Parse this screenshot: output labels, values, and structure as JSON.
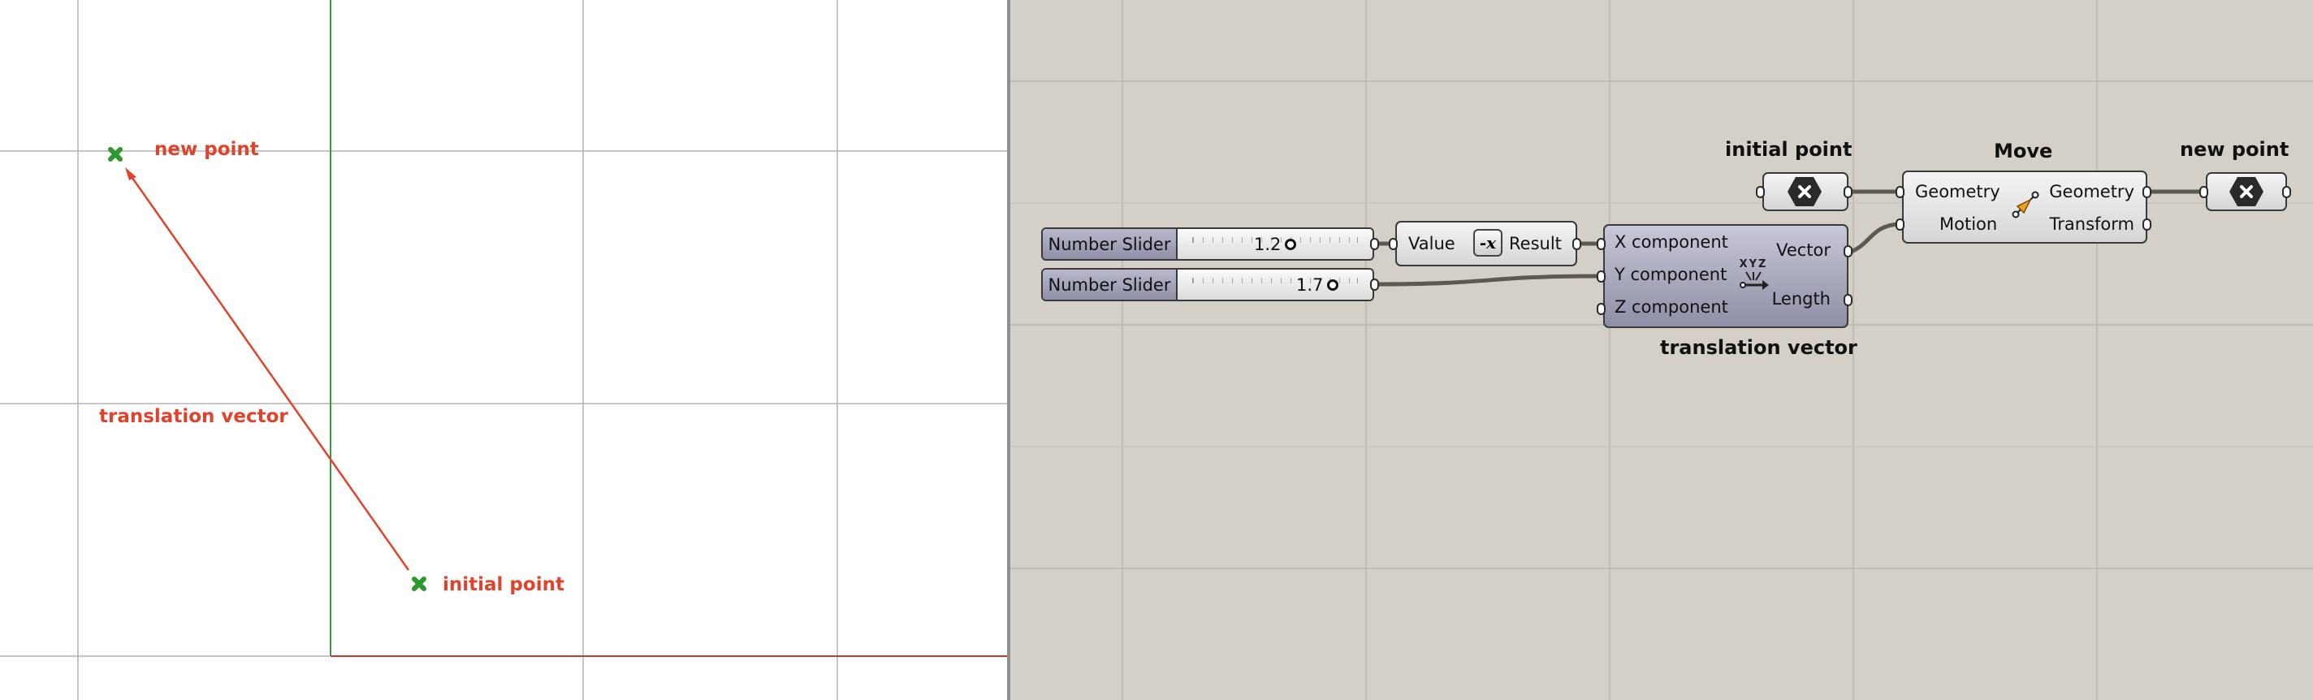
{
  "viewport": {
    "labels": {
      "new_point": "new point",
      "initial_point": "initial point",
      "translation_vector": "translation vector"
    },
    "colors": {
      "point": "#2e9a2e",
      "vector": "#e0432b",
      "grid": "#b4b4b4",
      "y_axis": "#3c9a3c",
      "x_axis": "#c03a2b"
    }
  },
  "canvas": {
    "background": "#d4d0c8",
    "slider1": {
      "name": "Number Slider",
      "value": "1.2"
    },
    "slider2": {
      "name": "Number Slider",
      "value": "1.7"
    },
    "negative": {
      "input": "Value",
      "output": "Result",
      "icon": "-x"
    },
    "vector_xyz": {
      "title": "translation vector",
      "inputs": [
        "X component",
        "Y component",
        "Z component"
      ],
      "outputs": [
        "Vector",
        "Length"
      ],
      "icon_label": "XYZ"
    },
    "initial_point_param": {
      "title": "initial point"
    },
    "move": {
      "title": "Move",
      "inputs": [
        "Geometry",
        "Motion"
      ],
      "outputs": [
        "Geometry",
        "Transform"
      ]
    },
    "new_point_param": {
      "title": "new point"
    }
  }
}
